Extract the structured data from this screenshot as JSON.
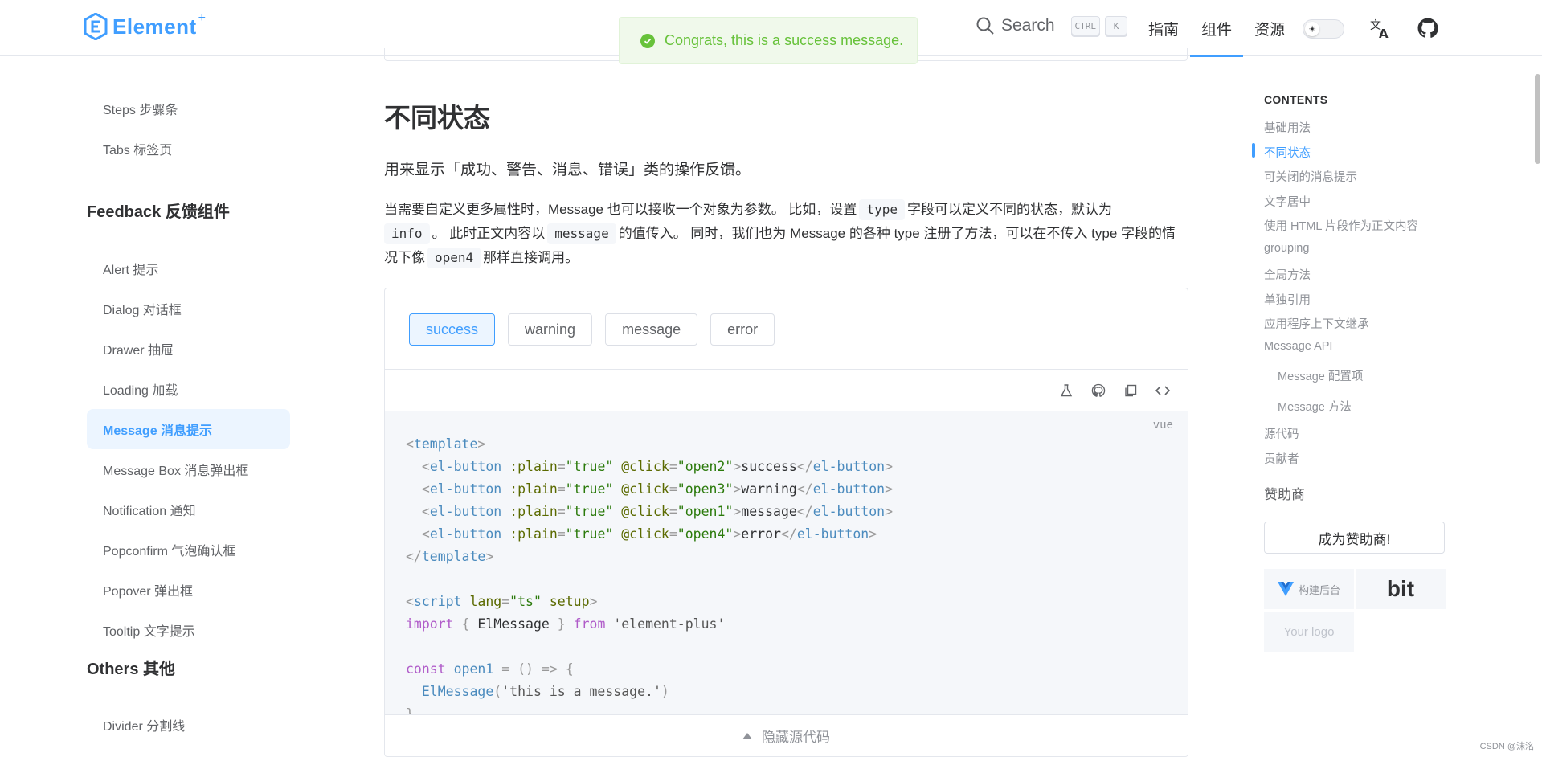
{
  "header": {
    "logo_text": "Element",
    "logo_plus": "+",
    "search_label": "Search",
    "search_keys": [
      "CTRL",
      "K"
    ],
    "nav": [
      "指南",
      "组件",
      "资源"
    ],
    "active_nav": "组件"
  },
  "toast": {
    "text": "Congrats, this is a success message.",
    "color": "#67c23a"
  },
  "sidebar": {
    "items_top": [
      "Steps 步骤条",
      "Tabs 标签页"
    ],
    "group_feedback": "Feedback 反馈组件",
    "items_feedback": [
      "Alert 提示",
      "Dialog 对话框",
      "Drawer 抽屉",
      "Loading 加载",
      "Message 消息提示",
      "Message Box 消息弹出框",
      "Notification 通知",
      "Popconfirm 气泡确认框",
      "Popover 弹出框",
      "Tooltip 文字提示"
    ],
    "active_item": "Message 消息提示",
    "group_others": "Others 其他",
    "items_others": [
      "Divider 分割线"
    ]
  },
  "main": {
    "heading": "不同状态",
    "intro": "用来显示「成功、警告、消息、错误」类的操作反馈。",
    "para": {
      "s1": "当需要自定义更多属性时，Message 也可以接收一个对象为参数。 比如，设置",
      "c1": "type",
      "s2": "字段可以定义不同的状态，默认为",
      "c2": "info",
      "s3": "。 此时正文内容以",
      "c3": "message",
      "s4": "的值传入。 同时，我们也为 Message 的各种 type 注册了方法，可以在不传入 type 字段的情况下像",
      "c4": "open4",
      "s5": "那样直接调用。"
    },
    "demo_buttons": [
      "success",
      "warning",
      "message",
      "error"
    ],
    "code_lang": "vue",
    "toggle_source_label": "隐藏源代码"
  },
  "toc": {
    "title": "CONTENTS",
    "items": [
      "基础用法",
      "不同状态",
      "可关闭的消息提示",
      "文字居中",
      "使用 HTML 片段作为正文内容",
      "grouping",
      "全局方法",
      "单独引用",
      "应用程序上下文继承",
      "Message API"
    ],
    "sub_items": [
      "Message 配置项",
      "Message 方法"
    ],
    "items_after": [
      "源代码",
      "贡献者"
    ],
    "active": "不同状态",
    "sponsor_title": "赞助商",
    "sponsor_button": "成为赞助商!",
    "sponsor_1": "构建后台",
    "sponsor_2": "bit",
    "sponsor_3": "Your logo"
  },
  "credit": "CSDN @沫洺",
  "colors": {
    "primary": "#409eff",
    "success": "#67c23a",
    "text": "#303133",
    "muted": "#909399"
  }
}
